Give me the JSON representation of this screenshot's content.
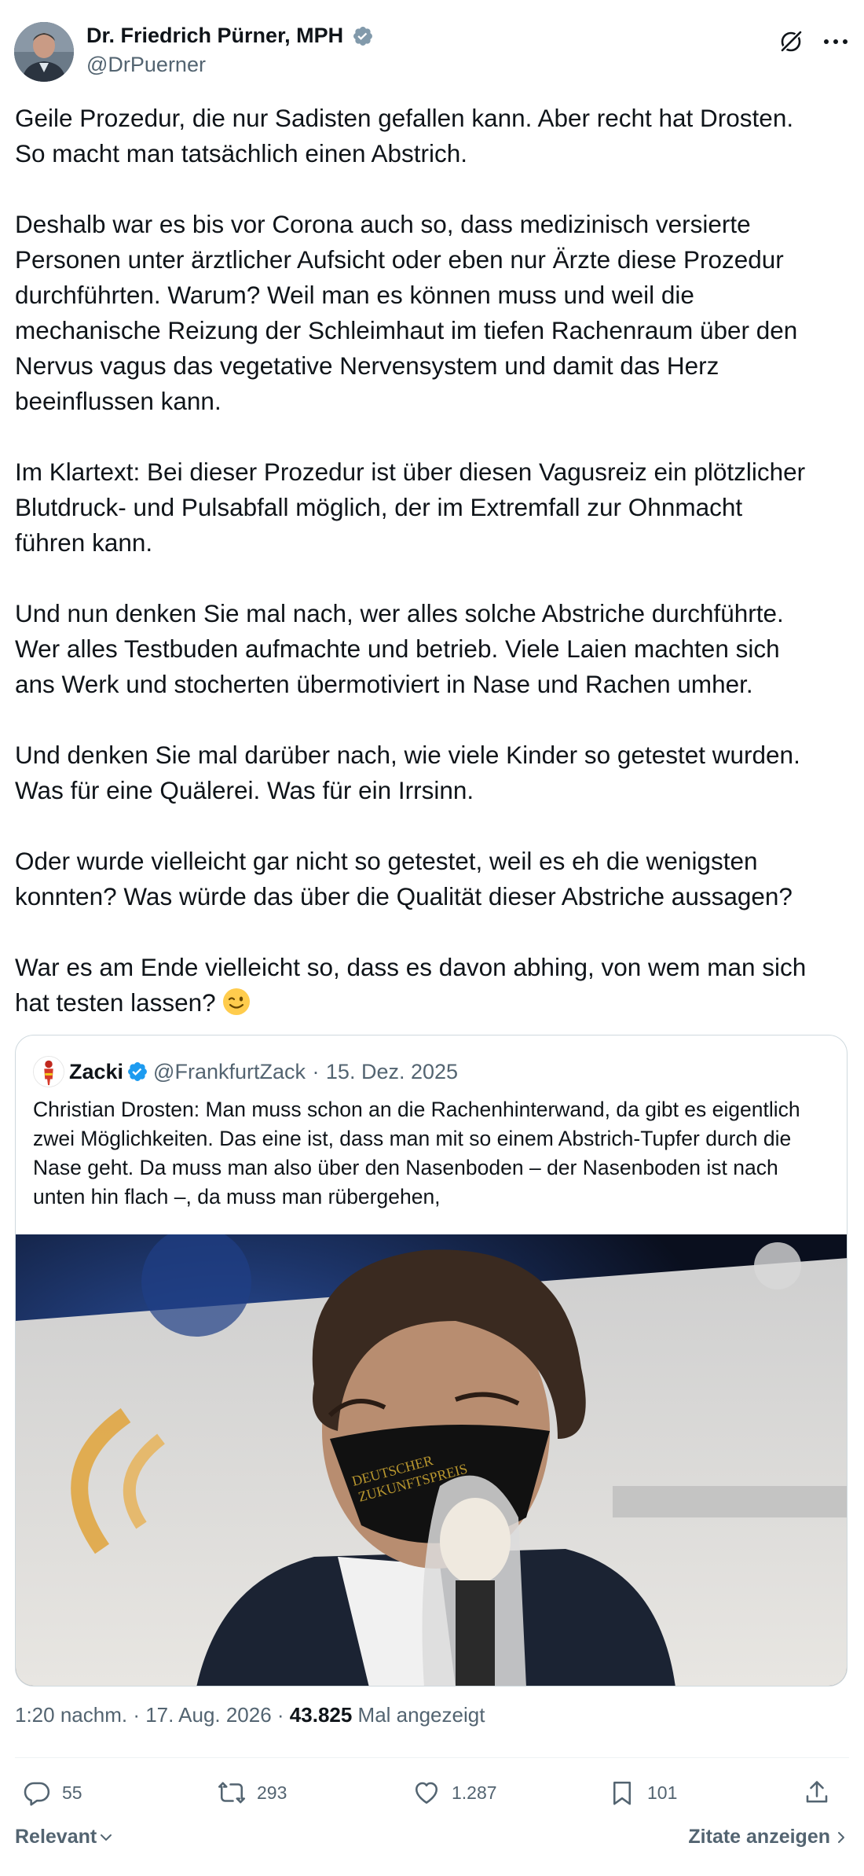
{
  "author": {
    "display_name": "Dr. Friedrich Pürner, MPH",
    "handle": "@DrPuerner",
    "verified": true
  },
  "tweet": {
    "text": "Geile Prozedur, die nur Sadisten gefallen kann. Aber recht hat Drosten.\nSo macht man tatsächlich einen Abstrich.\n\nDeshalb war es bis vor Corona auch so, dass medizinisch versierte\nPersonen unter ärztlicher Aufsicht oder eben nur Ärzte diese Prozedur\ndurchführten. Warum? Weil man es können muss und weil die\nmechanische Reizung der Schleimhaut im tiefen Rachenraum über den\nNervus vagus das vegetative Nervensystem und damit das Herz\nbeeinflussen kann.\n\nIm Klartext: Bei dieser Prozedur ist über diesen Vagusreiz ein plötzlicher\nBlutdruck- und Pulsabfall möglich, der im Extremfall zur Ohnmacht\nführen kann.\n\nUnd nun denken Sie mal nach, wer alles solche Abstriche durchführte.\nWer alles Testbuden aufmachte und betrieb. Viele Laien machten sich\nans Werk und stocherten übermotiviert in Nase und Rachen umher.\n\nUnd denken Sie mal darüber nach, wie viele Kinder so getestet wurden.\nWas für eine Quälerei. Was für ein Irrsinn.\n\nOder wurde vielleicht gar nicht so getestet, weil es eh die wenigsten\nkonnten? Was würde das über die Qualität dieser Abstriche aussagen?\n\nWar es am Ende vielleicht so, dass es davon abhing, von wem man sich\nhat testen lassen? ",
    "emoji": "winking-face"
  },
  "quote": {
    "display_name": "Zacki",
    "handle": "@FrankfurtZack",
    "separator": "·",
    "date": "15. Dez. 2025",
    "text": "Christian Drosten: Man muss schon an die Rachenhinterwand, da gibt es eigentlich zwei Möglichkeiten. Das eine ist, dass man mit so einem Abstrich-Tupfer durch die Nase geht. Da muss man also über den Nasenboden – der Nasenboden ist nach unten hin flach –, da muss man rübergehen,",
    "image_subject": "man-wearing-black-mask-with-microphone"
  },
  "meta": {
    "time": "1:20 nachm.",
    "sep1": " · ",
    "date": "17. Aug. 2026",
    "sep2": " · ",
    "views": "43.825",
    "views_label": " Mal angezeigt"
  },
  "actions": {
    "replies": "55",
    "reposts": "293",
    "likes": "1.287",
    "bookmarks": "101"
  },
  "footer": {
    "sort_label": "Relevant",
    "quotes_label": "Zitate anzeigen"
  },
  "colors": {
    "text": "#0f1419",
    "secondary": "#536471",
    "verified": "#1d9bf0",
    "border": "#cfd9de"
  },
  "icons": [
    "grok-icon",
    "more-icon",
    "verified-badge-icon",
    "reply-icon",
    "repost-icon",
    "like-icon",
    "bookmark-icon",
    "share-icon",
    "chevron-down-icon",
    "chevron-right-icon"
  ]
}
